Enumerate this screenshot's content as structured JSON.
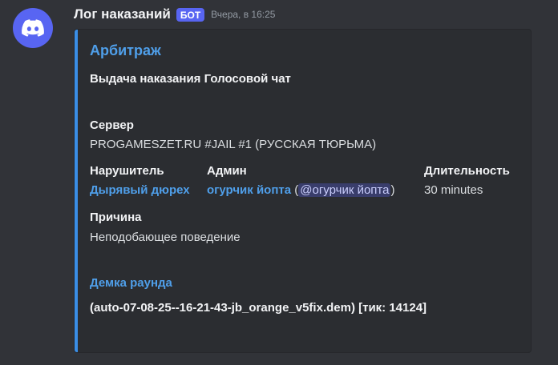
{
  "message": {
    "username": "Лог наказаний",
    "bot_tag": "БОТ",
    "timestamp": "Вчера, в 16:25",
    "avatar_icon": "discord-logo-icon",
    "accent_color": "#3a8ee6"
  },
  "embed": {
    "title": "Арбитраж",
    "description": "Выдача наказания Голосовой чат",
    "fields": {
      "server": {
        "name": "Сервер",
        "value": "PROGAMESZET.RU #JAIL #1 (РУССКАЯ ТЮРЬМА)"
      },
      "violator": {
        "name": "Нарушитель",
        "value": "Дырявый дюрех"
      },
      "admin": {
        "name": "Админ",
        "value": "огурчик йопта",
        "paren_open": "(",
        "mention": "@огурчик йопта",
        "paren_close": ")"
      },
      "duration": {
        "name": "Длительность",
        "value": "30 minutes"
      },
      "reason": {
        "name": "Причина",
        "value": "Неподобающее поведение"
      }
    },
    "demo": {
      "link": "Демка раунда",
      "value": "(auto-07-08-25--16-21-43-jb_orange_v5fix.dem) [тик: 14124]"
    }
  }
}
